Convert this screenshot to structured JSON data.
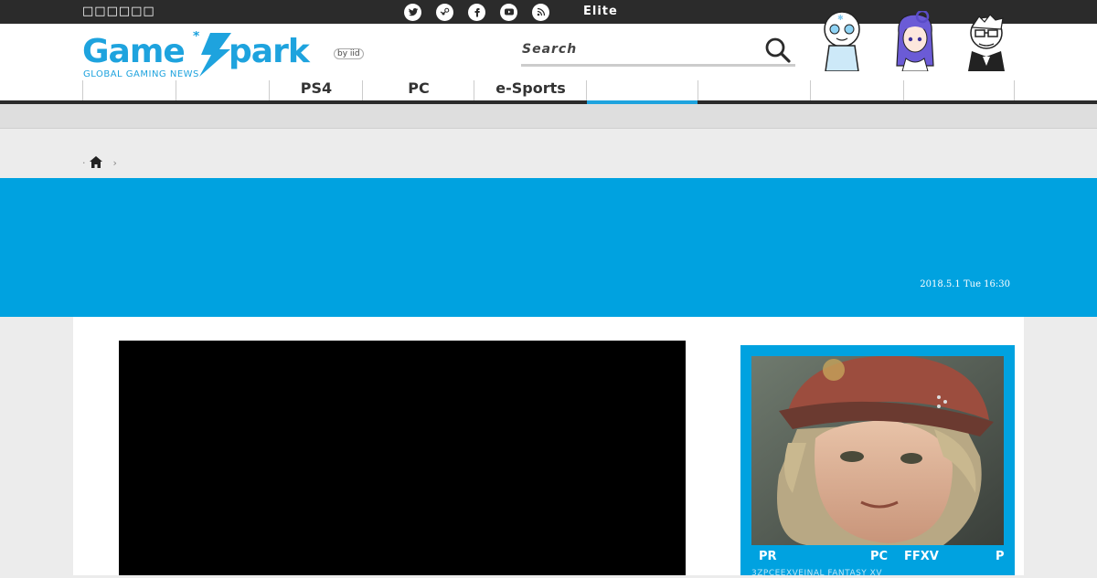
{
  "topbar": {
    "tagline": "□□□□□□",
    "social_icons": [
      "twitter-icon",
      "steam-icon",
      "facebook-icon",
      "youtube-icon",
      "rss-icon"
    ],
    "extra_glyph": "",
    "elite_label": "Elite",
    "elite_glyph": ""
  },
  "header": {
    "logo_text": "GameSpark",
    "logo_tagline": "GLOBAL GAMING NEWS",
    "logo_badge": "by iid",
    "search_placeholder": "Search",
    "accent_color": "#1ea3de"
  },
  "nav": {
    "items": [
      {
        "label": ""
      },
      {
        "label": ""
      },
      {
        "label": "PS4"
      },
      {
        "label": "PC"
      },
      {
        "label": "e-Sports"
      },
      {
        "label": ""
      },
      {
        "label": ""
      },
      {
        "label": ""
      },
      {
        "label": ""
      }
    ],
    "active_index": 5
  },
  "breadcrumb": {
    "separator": "›"
  },
  "article": {
    "date": "2018.5.1 Tue 16:30",
    "banner_color": "#00a2e0"
  },
  "promo": {
    "label_pr": "PR",
    "label_pc": "PC",
    "label_game": "FFXV",
    "label_p": "P",
    "subtitle": "3ZPCEEXVEINAL FANTASY XV"
  }
}
